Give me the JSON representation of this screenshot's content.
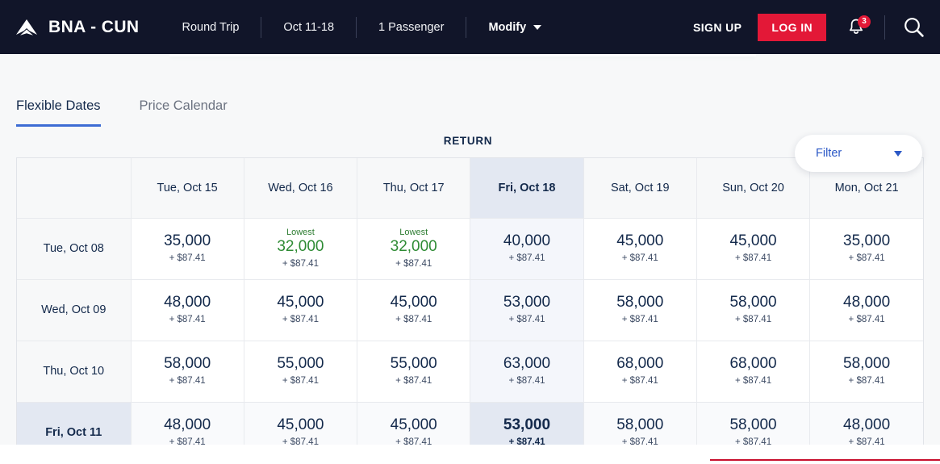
{
  "header": {
    "logo_icon": "delta-widget-logo",
    "route": "BNA - CUN",
    "trip_type": "Round Trip",
    "dates": "Oct 11-18",
    "passengers": "1 Passenger",
    "modify_label": "Modify",
    "modify_caret_icon": "caret-down-icon",
    "sign_up": "SIGN UP",
    "log_in": "LOG IN",
    "bell_icon": "notification-bell-icon",
    "bell_count": "3",
    "search_icon": "search-icon",
    "colors": {
      "bar_bg": "#111529",
      "accent_red": "#e31837"
    }
  },
  "tabs": [
    {
      "label": "Flexible Dates",
      "active": true
    },
    {
      "label": "Price Calendar",
      "active": false
    }
  ],
  "filter": {
    "label": "Filter",
    "caret_icon": "caret-down-icon",
    "color": "#2b58c6"
  },
  "grid": {
    "return_label": "RETURN",
    "corner_label": "",
    "selected_column": "Fri, Oct 18",
    "selected_row": "Fri, Oct 11",
    "columns": [
      "Tue, Oct 15",
      "Wed, Oct 16",
      "Thu, Oct 17",
      "Fri, Oct 18",
      "Sat, Oct 19",
      "Sun, Oct 20",
      "Mon, Oct 21"
    ],
    "lowest_tag": "Lowest",
    "rows": [
      {
        "label": "Tue, Oct 08",
        "cells": [
          {
            "miles": "35,000",
            "taxes": "+ $87.41",
            "lowest": false
          },
          {
            "miles": "32,000",
            "taxes": "+ $87.41",
            "lowest": true
          },
          {
            "miles": "32,000",
            "taxes": "+ $87.41",
            "lowest": true
          },
          {
            "miles": "40,000",
            "taxes": "+ $87.41",
            "lowest": false
          },
          {
            "miles": "45,000",
            "taxes": "+ $87.41",
            "lowest": false
          },
          {
            "miles": "45,000",
            "taxes": "+ $87.41",
            "lowest": false
          },
          {
            "miles": "35,000",
            "taxes": "+ $87.41",
            "lowest": false
          }
        ]
      },
      {
        "label": "Wed, Oct 09",
        "cells": [
          {
            "miles": "48,000",
            "taxes": "+ $87.41",
            "lowest": false
          },
          {
            "miles": "45,000",
            "taxes": "+ $87.41",
            "lowest": false
          },
          {
            "miles": "45,000",
            "taxes": "+ $87.41",
            "lowest": false
          },
          {
            "miles": "53,000",
            "taxes": "+ $87.41",
            "lowest": false
          },
          {
            "miles": "58,000",
            "taxes": "+ $87.41",
            "lowest": false
          },
          {
            "miles": "58,000",
            "taxes": "+ $87.41",
            "lowest": false
          },
          {
            "miles": "48,000",
            "taxes": "+ $87.41",
            "lowest": false
          }
        ]
      },
      {
        "label": "Thu, Oct 10",
        "cells": [
          {
            "miles": "58,000",
            "taxes": "+ $87.41",
            "lowest": false
          },
          {
            "miles": "55,000",
            "taxes": "+ $87.41",
            "lowest": false
          },
          {
            "miles": "55,000",
            "taxes": "+ $87.41",
            "lowest": false
          },
          {
            "miles": "63,000",
            "taxes": "+ $87.41",
            "lowest": false
          },
          {
            "miles": "68,000",
            "taxes": "+ $87.41",
            "lowest": false
          },
          {
            "miles": "68,000",
            "taxes": "+ $87.41",
            "lowest": false
          },
          {
            "miles": "58,000",
            "taxes": "+ $87.41",
            "lowest": false
          }
        ]
      },
      {
        "label": "Fri, Oct 11",
        "selected": true,
        "cells": [
          {
            "miles": "48,000",
            "taxes": "+ $87.41",
            "lowest": false
          },
          {
            "miles": "45,000",
            "taxes": "+ $87.41",
            "lowest": false
          },
          {
            "miles": "45,000",
            "taxes": "+ $87.41",
            "lowest": false
          },
          {
            "miles": "53,000",
            "taxes": "+ $87.41",
            "lowest": false
          },
          {
            "miles": "58,000",
            "taxes": "+ $87.41",
            "lowest": false
          },
          {
            "miles": "58,000",
            "taxes": "+ $87.41",
            "lowest": false
          },
          {
            "miles": "48,000",
            "taxes": "+ $87.41",
            "lowest": false
          }
        ]
      }
    ]
  }
}
